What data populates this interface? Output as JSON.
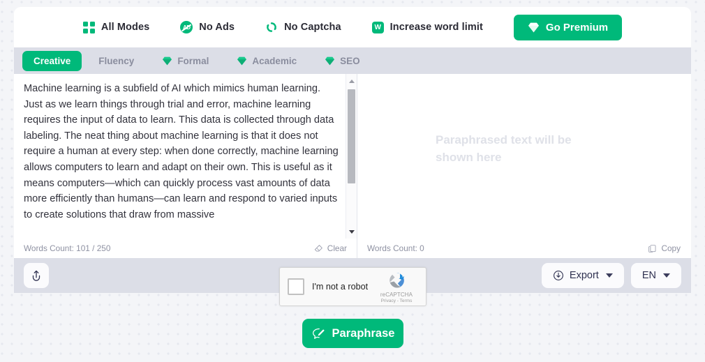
{
  "promo_bar": {
    "items": [
      {
        "label": "All Modes",
        "icon": "grid-icon"
      },
      {
        "label": "No Ads",
        "icon": "no-ads-icon"
      },
      {
        "label": "No Captcha",
        "icon": "refresh-captcha-icon"
      },
      {
        "label": "Increase word limit",
        "icon": "word-badge-icon"
      }
    ],
    "premium_button": {
      "label": "Go Premium",
      "icon": "gem-icon"
    }
  },
  "modes": {
    "tabs": [
      {
        "label": "Creative",
        "active": true,
        "premium": false
      },
      {
        "label": "Fluency",
        "active": false,
        "premium": false
      },
      {
        "label": "Formal",
        "active": false,
        "premium": true
      },
      {
        "label": "Academic",
        "active": false,
        "premium": true
      },
      {
        "label": "SEO",
        "active": false,
        "premium": true
      }
    ]
  },
  "editor": {
    "source": {
      "text": "Machine learning is a subfield of AI which mimics human learning. Just as we learn things through trial and error, machine learning requires the input of data to learn. This data is collected through data labeling. The neat thing about machine learning is that it does not require a human at every step: when done correctly, machine learning allows computers to learn and adapt on their own. This is useful as it means computers—which can quickly process vast amounts of data more efficiently than humans—can learn and respond to varied inputs to create solutions that draw from massive",
      "words_count_label": "Words Count: 101 / 250",
      "clear_label": "Clear",
      "clear_icon": "eraser-icon"
    },
    "output": {
      "placeholder": "Paraphrased text will be shown here",
      "words_count_label": "Words Count: 0",
      "copy_label": "Copy",
      "copy_icon": "copy-icon"
    }
  },
  "toolbar": {
    "upload_icon": "upload-icon",
    "export": {
      "label": "Export",
      "icon": "download-circle-icon",
      "chevron": "chevron-down-icon"
    },
    "language": {
      "value": "EN",
      "chevron": "chevron-down-icon"
    }
  },
  "recaptcha": {
    "checkbox_label": "I'm not a robot",
    "brand": "reCAPTCHA",
    "terms": "Privacy - Terms",
    "logo_icon": "recaptcha-logo-icon"
  },
  "action": {
    "paraphrase_label": "Paraphrase",
    "paraphrase_icon": "paraphrase-pencil-icon"
  },
  "colors": {
    "brand_green": "#00b97a",
    "toolbar_grey": "#dcdee7",
    "page_bg": "#f4f5f8"
  }
}
